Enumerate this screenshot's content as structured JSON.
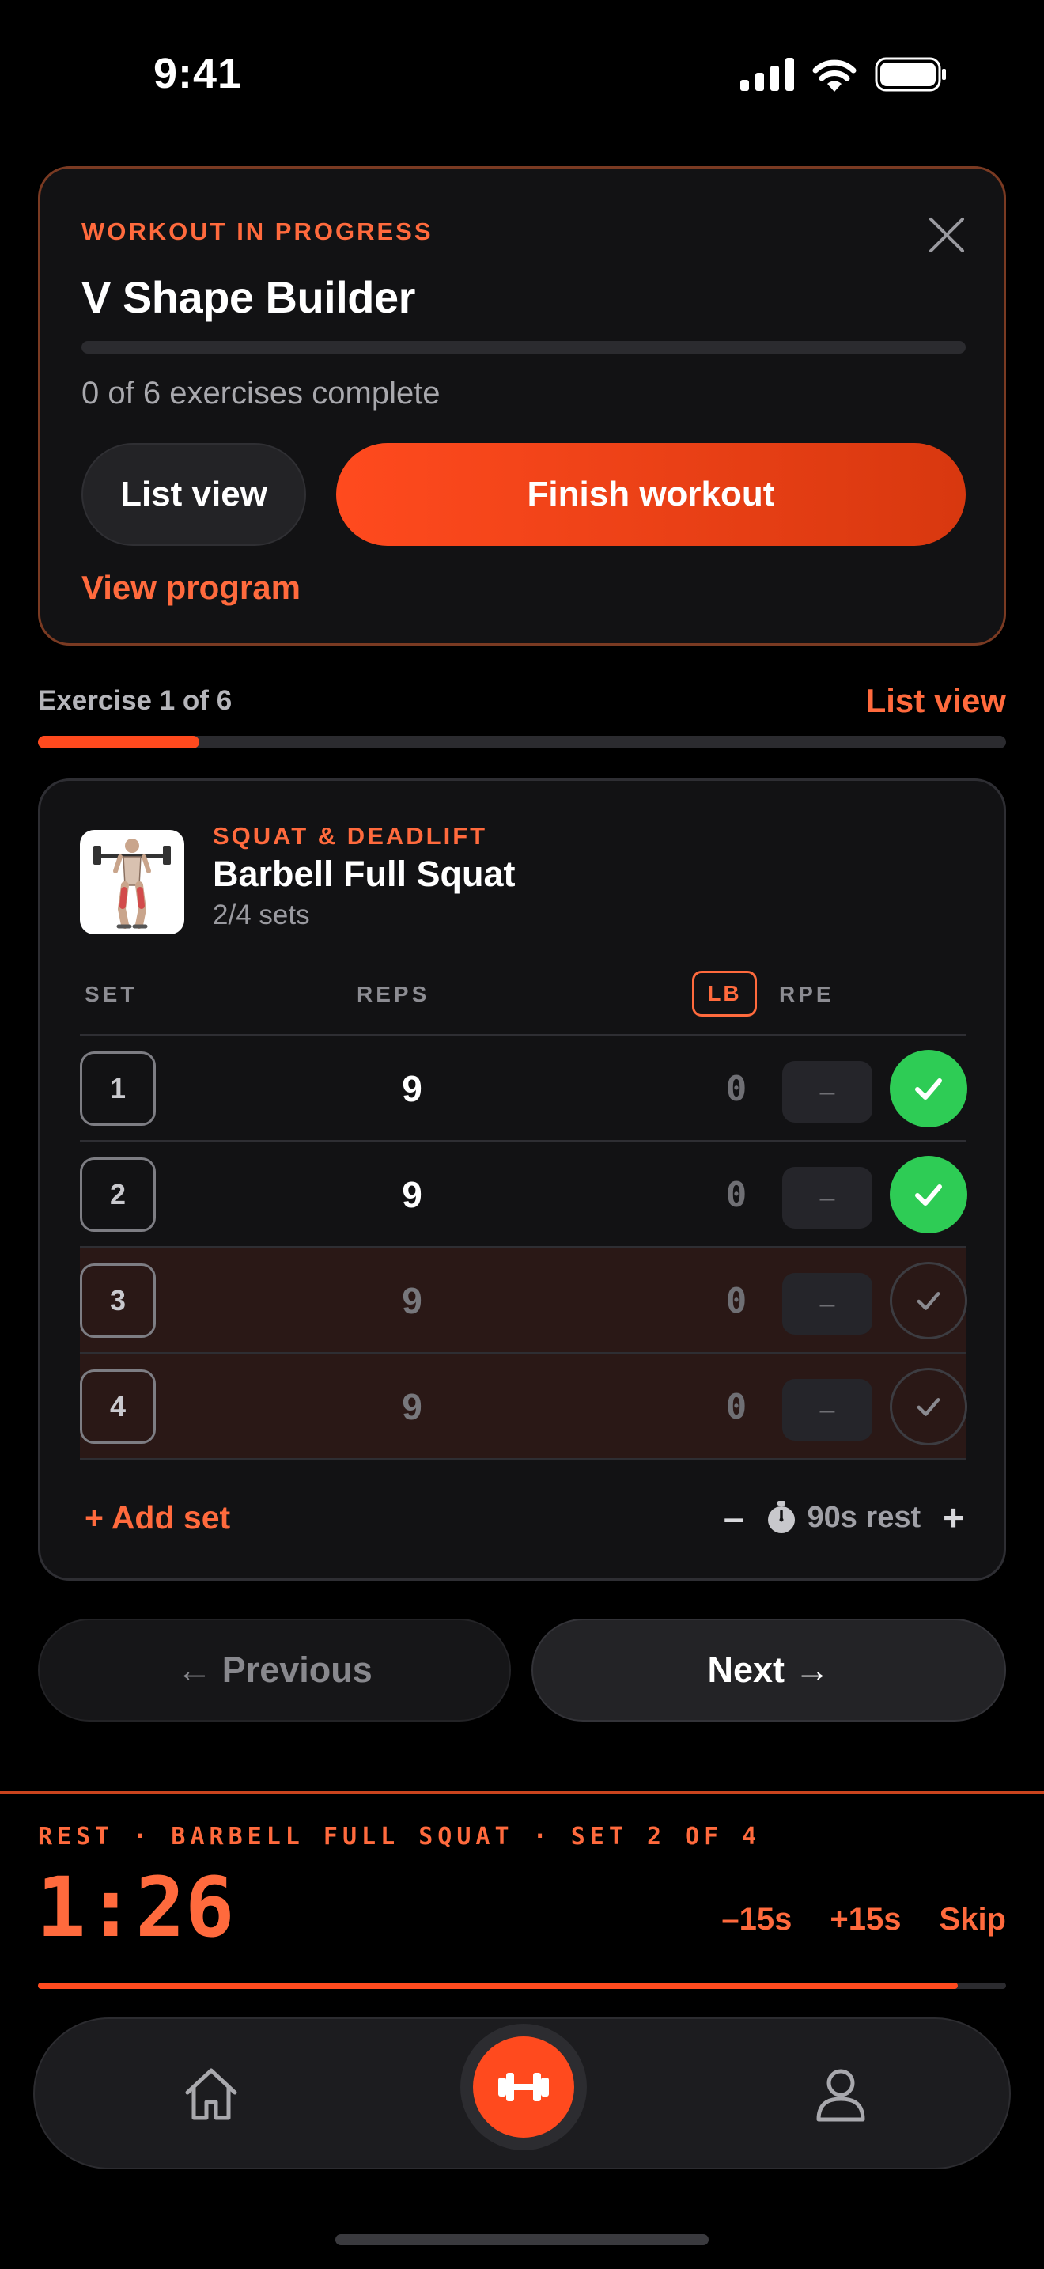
{
  "status_bar": {
    "time": "9:41"
  },
  "workout": {
    "kicker": "WORKOUT IN PROGRESS",
    "title": "V Shape Builder",
    "progress_text": "0 of 6 exercises complete",
    "progress_fraction": 0,
    "list_view_label": "List view",
    "finish_label": "Finish workout",
    "view_program_label": "View program"
  },
  "exercise_nav": {
    "label": "Exercise 1 of 6",
    "list_view_label": "List view",
    "progress_fraction": 0.167
  },
  "exercise": {
    "category": "SQUAT & DEADLIFT",
    "name": "Barbell Full Squat",
    "sets_done": "2/4 sets",
    "columns": {
      "set": "SET",
      "reps": "REPS",
      "unit": "LB",
      "rpe": "RPE"
    },
    "sets": [
      {
        "num": "1",
        "reps": "9",
        "weight": "0",
        "rpe": "–",
        "done": true
      },
      {
        "num": "2",
        "reps": "9",
        "weight": "0",
        "rpe": "–",
        "done": true
      },
      {
        "num": "3",
        "reps": "9",
        "weight": "0",
        "rpe": "–",
        "done": false
      },
      {
        "num": "4",
        "reps": "9",
        "weight": "0",
        "rpe": "–",
        "done": false
      }
    ],
    "add_set_label": "+ Add set",
    "rest_minus": "–",
    "rest_plus": "+",
    "rest_label": "90s rest"
  },
  "nav": {
    "previous_label": "← Previous",
    "next_label": "Next →"
  },
  "rest_timer": {
    "kicker": "REST · BARBELL FULL SQUAT · SET 2 OF 4",
    "time": "1:26",
    "minus_label": "–15s",
    "plus_label": "+15s",
    "skip_label": "Skip",
    "progress_fraction": 0.95
  },
  "colors": {
    "accent": "#ff4a1e",
    "accent_text": "#ff6a3d",
    "success": "#2ecc55",
    "background": "#000000",
    "card": "#121214"
  },
  "icons": [
    "signal-icon",
    "wifi-icon",
    "battery-icon",
    "close-icon",
    "stopwatch-icon",
    "home-icon",
    "dumbbell-icon",
    "profile-icon",
    "check-icon"
  ]
}
